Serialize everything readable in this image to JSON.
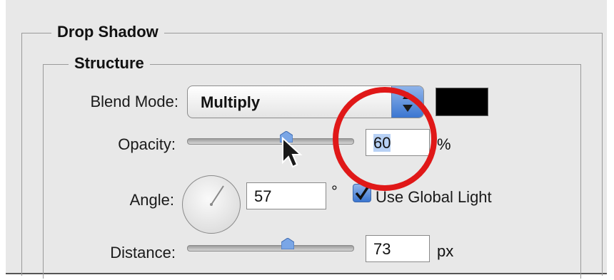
{
  "dialog": {
    "section_title": "Drop Shadow",
    "subsection_title": "Structure"
  },
  "blend_mode": {
    "label": "Blend Mode:",
    "value": "Multiply",
    "shadow_color": "#000000"
  },
  "opacity": {
    "label": "Opacity:",
    "value": "60",
    "unit": "%",
    "slider_fraction": 0.6
  },
  "angle": {
    "label": "Angle:",
    "value": "57",
    "unit": "°",
    "use_global_light_label": "Use Global Light",
    "use_global_light_checked": true
  },
  "distance": {
    "label": "Distance:",
    "value": "73",
    "unit": "px"
  },
  "colors": {
    "annotation": "#e01818",
    "accent": "#3b76d1"
  },
  "icons": [
    "select-arrows-icon",
    "slider-thumb-icon",
    "mouse-pointer-icon",
    "checkmark-icon"
  ]
}
